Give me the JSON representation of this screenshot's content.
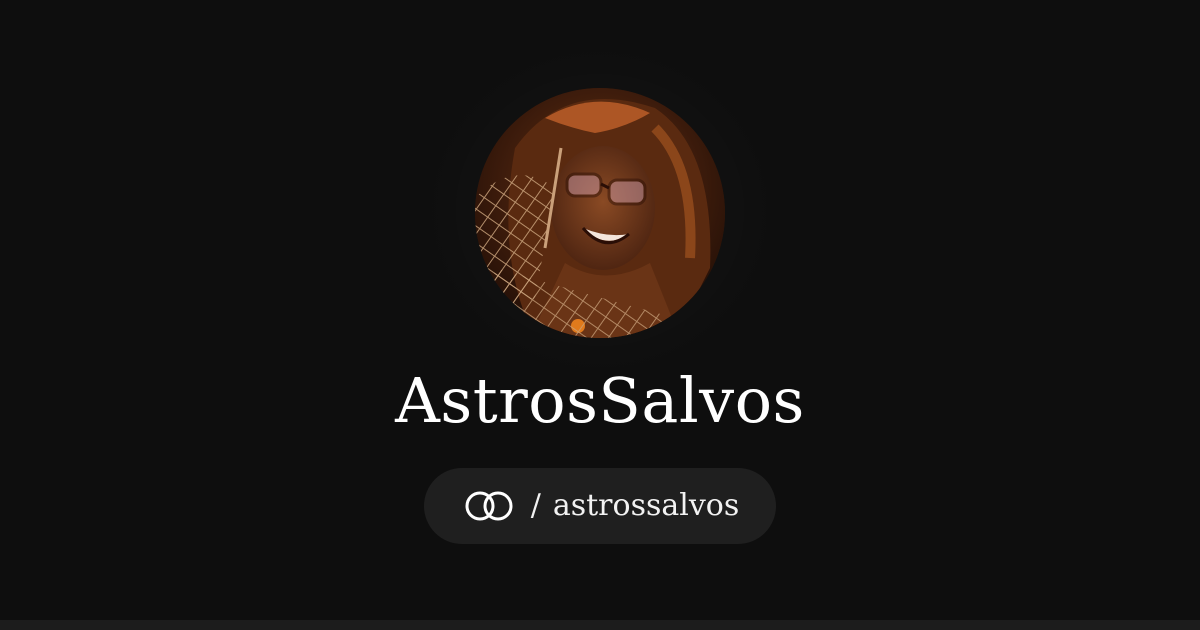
{
  "profile": {
    "display_name": "AstrosSalvos",
    "separator": "/",
    "handle": "astrossalvos",
    "avatar_alt": "Profile avatar artwork"
  },
  "icons": {
    "brand": "linked-rings-icon"
  },
  "colors": {
    "background": "#0e0e0e",
    "pill": "#1f1f1f",
    "text": "#ffffff"
  }
}
